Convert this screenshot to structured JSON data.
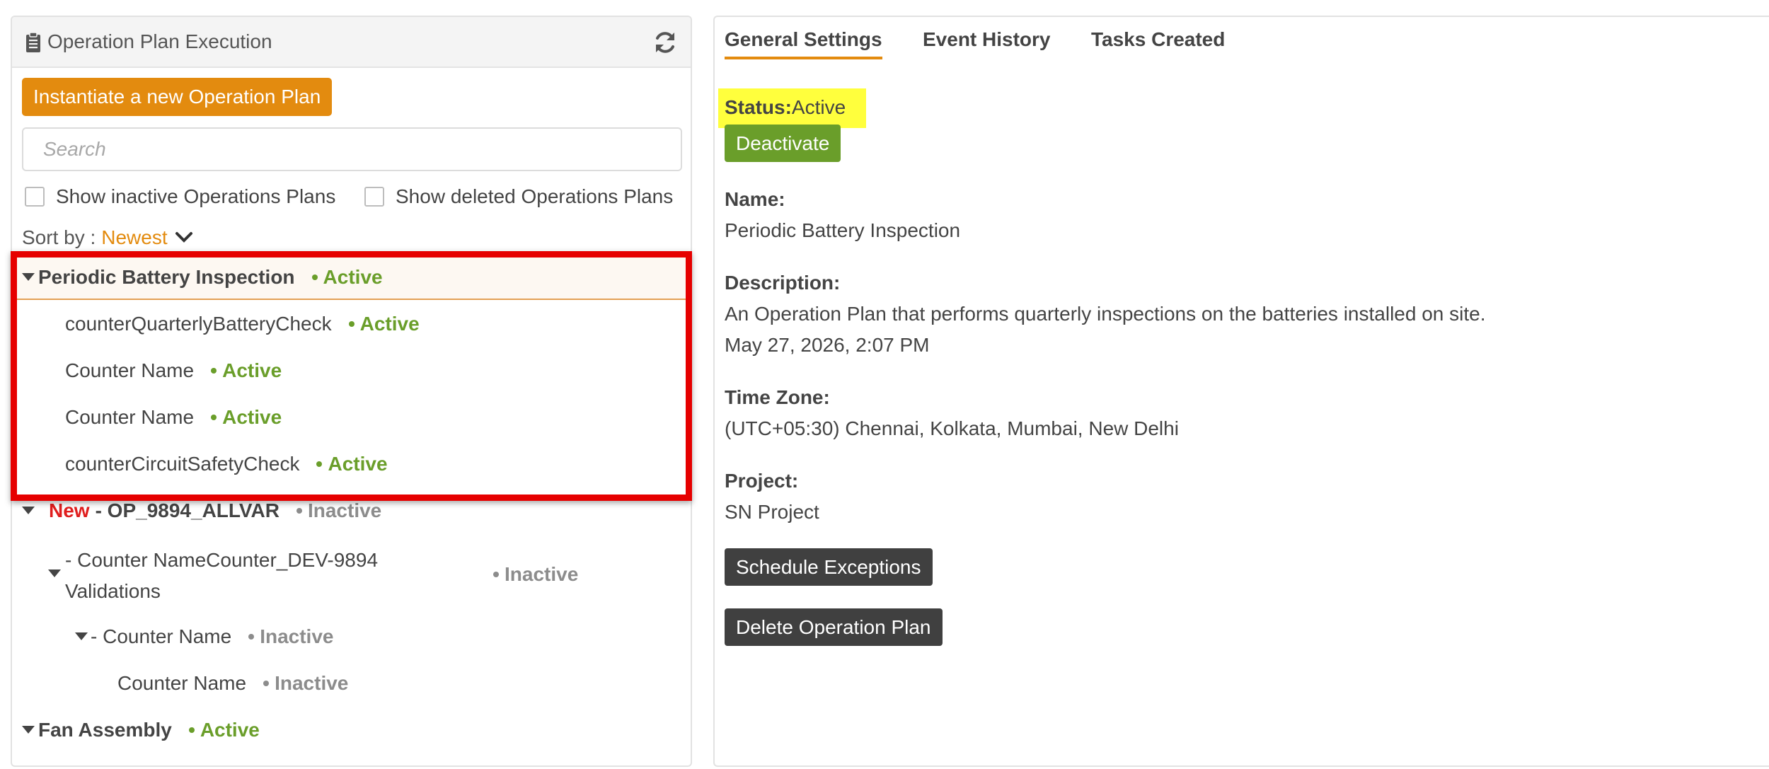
{
  "left": {
    "title": "Operation Plan Execution",
    "instantiate_label": "Instantiate a new Operation Plan",
    "search_placeholder": "Search",
    "show_inactive_label": "Show inactive Operations Plans",
    "show_deleted_label": "Show deleted Operations Plans",
    "sort_label": "Sort by :",
    "sort_value": "Newest",
    "tree": {
      "plan1": {
        "name": "Periodic Battery Inspection",
        "status": "Active",
        "counters": [
          {
            "name": "counterQuarterlyBatteryCheck",
            "status": "Active"
          },
          {
            "name": "Counter Name",
            "status": "Active"
          },
          {
            "name": "Counter Name",
            "status": "Active"
          },
          {
            "name": "counterCircuitSafetyCheck",
            "status": "Active"
          }
        ]
      },
      "plan2": {
        "new_tag": "New",
        "name": "- OP_9894_ALLVAR",
        "status": "Inactive",
        "child_line1": "- Counter NameCounter_DEV-9894",
        "child_line2": "Validations",
        "child_status": "Inactive",
        "grandchild": "- Counter Name",
        "grandchild_status": "Inactive",
        "leaf": "Counter Name",
        "leaf_status": "Inactive"
      },
      "plan3": {
        "name": "Fan Assembly",
        "status": "Active"
      }
    }
  },
  "right": {
    "tabs": [
      "General Settings",
      "Event History",
      "Tasks Created"
    ],
    "status_label": "Status:",
    "status_value": "Active",
    "deactivate_label": "Deactivate",
    "name_label": "Name:",
    "name_value": "Periodic Battery Inspection",
    "description_label": "Description:",
    "description_value": "An Operation Plan that performs quarterly inspections on the batteries installed on site.",
    "date_value": "May 27, 2026, 2:07 PM",
    "timezone_label": "Time Zone:",
    "timezone_value": "(UTC+05:30) Chennai, Kolkata, Mumbai, New Delhi",
    "project_label": "Project:",
    "project_value": "SN Project",
    "schedule_exceptions_label": "Schedule Exceptions",
    "delete_label": "Delete Operation Plan"
  },
  "colors": {
    "accent_orange": "#e38b0f",
    "active_green": "#6a9e2a",
    "inactive_gray": "#8c8c8c",
    "new_red": "#e01e1e",
    "highlight_red": "#e60000",
    "status_yellow": "#ffff3d",
    "dark_button": "#404040"
  },
  "icons": {
    "title": "clipboard-icon",
    "refresh": "refresh-icon",
    "sort": "chevron-down-icon",
    "expand": "caret-down-icon"
  }
}
